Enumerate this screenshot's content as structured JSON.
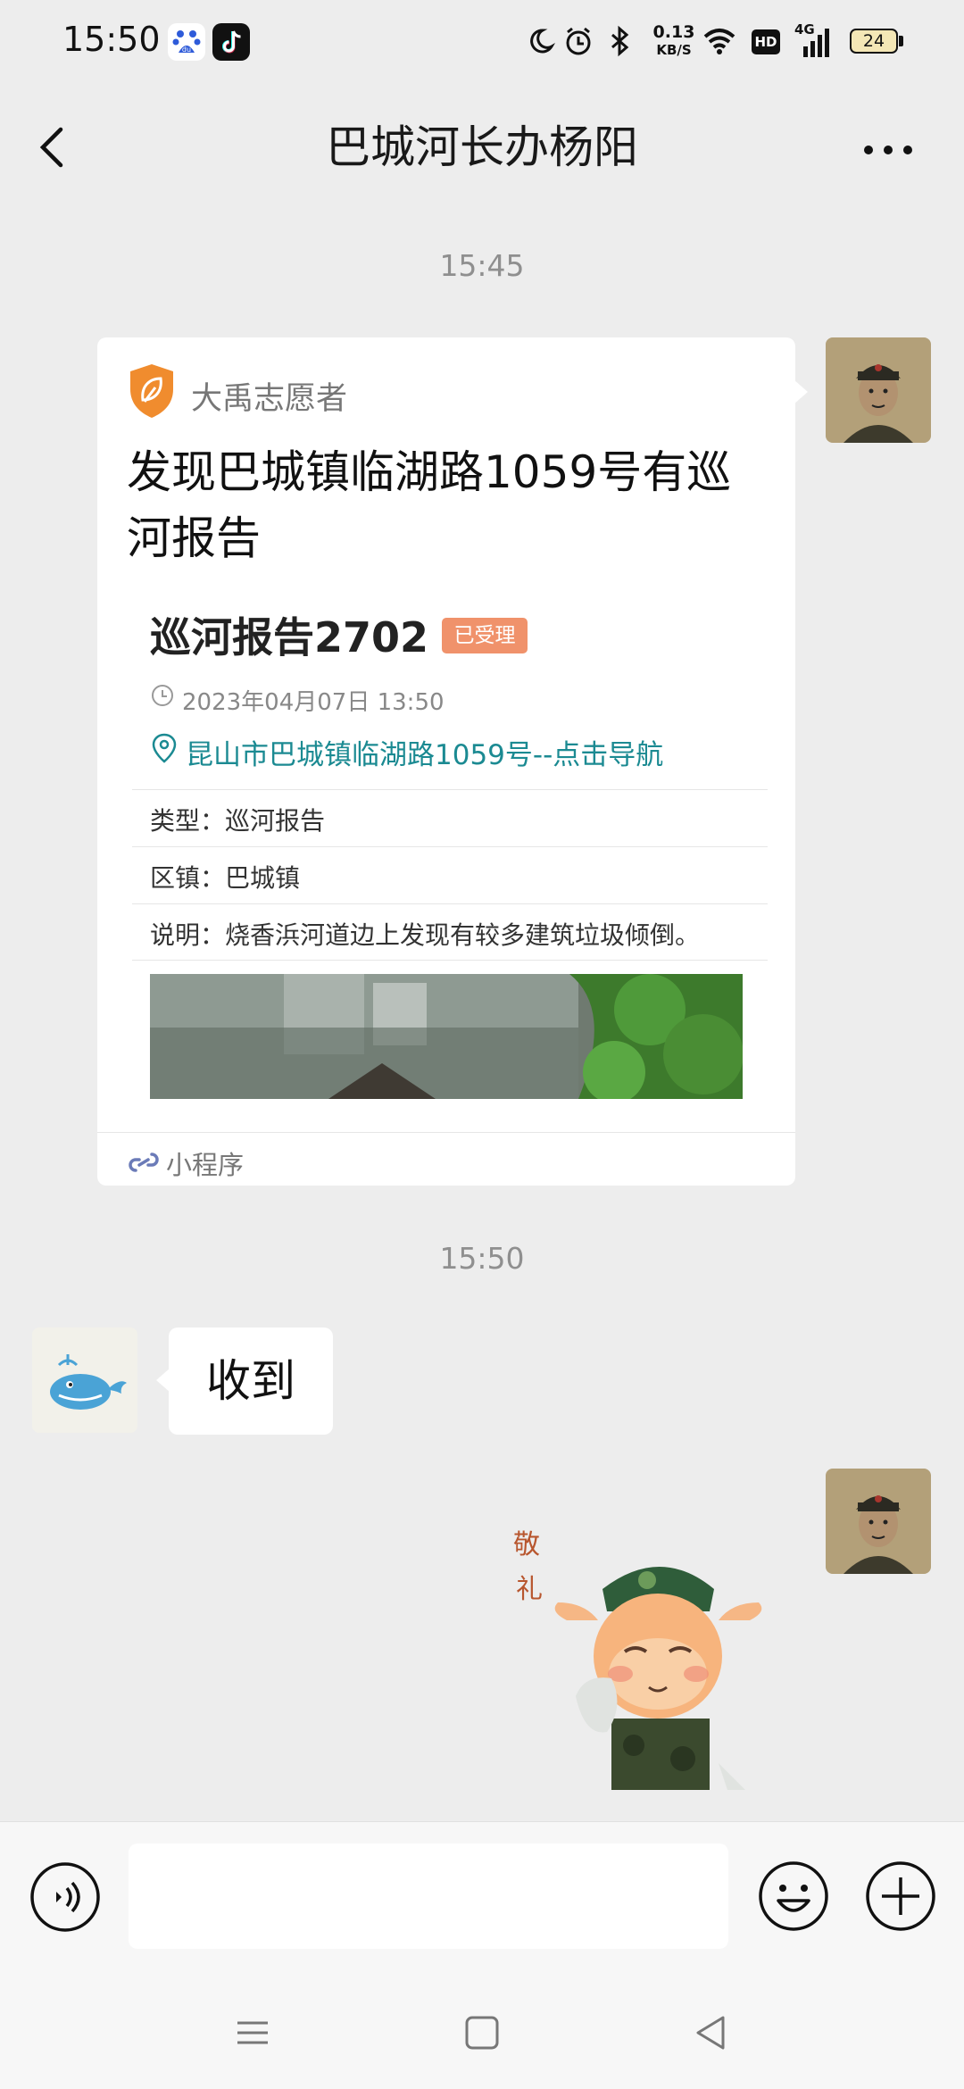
{
  "status_bar": {
    "time": "15:50",
    "net_speed_value": "0.13",
    "net_speed_unit": "KB/S",
    "hd_label": "HD",
    "network_type": "4G",
    "battery_level": "24"
  },
  "header": {
    "title": "巴城河长办杨阳"
  },
  "messages": {
    "timestamp_1": "15:45",
    "card": {
      "source_name": "大禹志愿者",
      "title": "发现巴城镇临湖路1059号有巡河报告",
      "report_title": "巡河报告2702",
      "status_badge": "已受理",
      "datetime": "2023年04月07日 13:50",
      "location_link": "昆山市巴城镇临湖路1059号--点击导航",
      "type_label": "类型",
      "type_value": "巡河报告",
      "district_label": "区镇",
      "district_value": "巴城镇",
      "description_label": "说明",
      "description_value": "烧香浜河道边上发现有较多建筑垃圾倾倒。",
      "footer_label": "小程序"
    },
    "timestamp_2": "15:50",
    "received_text": "收到",
    "sticker_text_1": "敬",
    "sticker_text_2": "礼"
  },
  "input_bar": {
    "input_value": ""
  },
  "colors": {
    "background": "#ededed",
    "link": "#1b8a92",
    "badge": "#f0926b",
    "shield": "#f08c2e"
  },
  "icons": [
    "baidu-icon",
    "tiktok-icon",
    "moon-icon",
    "alarm-icon",
    "bluetooth-icon",
    "wifi-icon",
    "signal-icon",
    "back-icon",
    "more-icon",
    "shield-leaf-icon",
    "clock-icon",
    "location-pin-icon",
    "mini-program-icon",
    "voice-icon",
    "emoji-icon",
    "plus-icon",
    "menu-icon",
    "home-icon",
    "back-triangle-icon"
  ]
}
